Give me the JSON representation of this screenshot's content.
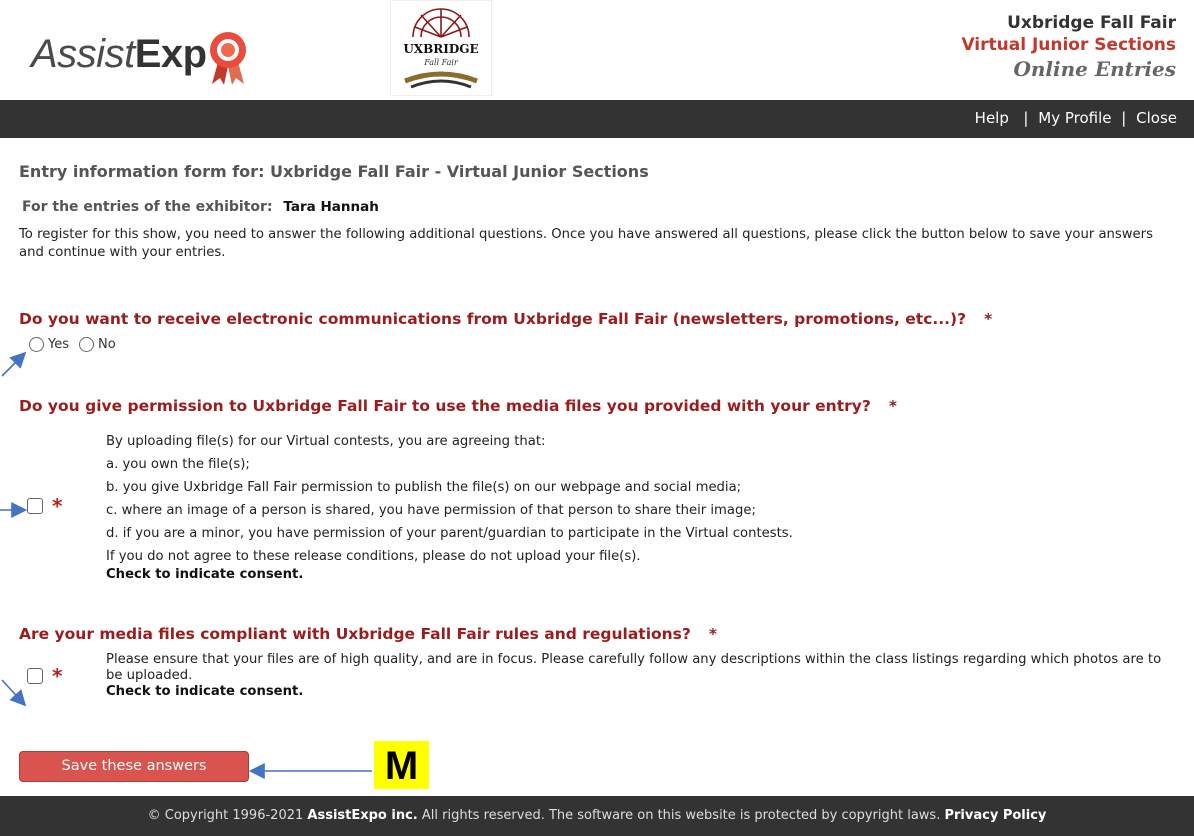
{
  "header": {
    "logo_light": "Assist",
    "logo_bold": "Exp",
    "badge_text": "UXBRIDGE",
    "badge_sub": "Fall Fair",
    "title_line1": "Uxbridge Fall Fair",
    "title_line2": "Virtual Junior Sections",
    "title_line3": "Online Entries"
  },
  "nav": {
    "help": "Help",
    "profile": "My Profile",
    "close": "Close"
  },
  "form": {
    "title": "Entry information form for: Uxbridge Fall Fair - Virtual Junior Sections",
    "exhibitor_label": "For the entries of the exhibitor:",
    "exhibitor_name": "Tara Hannah",
    "intro": "To register for this show, you need to answer the following additional questions. Once you have answered all questions, please click the button below to save your answers and continue with your entries."
  },
  "q1": {
    "title": "Do you want to receive electronic communications from Uxbridge Fall Fair (newsletters, promotions, etc...)?",
    "required": "*",
    "option_yes": "Yes",
    "option_no": "No"
  },
  "q2": {
    "title": "Do you give permission to Uxbridge Fall Fair to use the media files you provided with your entry?",
    "required": "*",
    "lines": [
      "By uploading file(s) for our Virtual contests, you are agreeing that:",
      "a. you own the file(s);",
      "b. you give Uxbridge Fall Fair permission to publish the file(s) on our webpage and social media;",
      "c. where an image of a person is shared, you have permission of that person to share their image;",
      "d. if you are a minor, you have permission of your parent/guardian to participate in the Virtual contests.",
      "If you do not agree to these release conditions, please do not upload your file(s)."
    ],
    "consent": "Check to indicate consent."
  },
  "q3": {
    "title": "Are your media files compliant with Uxbridge Fall Fair rules and regulations?",
    "required": "*",
    "text": "Please ensure that your files are of high quality, and are in focus. Please carefully follow any descriptions within the class listings regarding which photos are to be uploaded.",
    "consent": "Check to indicate consent."
  },
  "save_label": "Save these answers",
  "annotation_marker": "M",
  "footer": {
    "prefix": "© Copyright 1996-2021",
    "company": "AssistExpo inc.",
    "middle": "All rights reserved.  The software on this website is protected by copyright laws.",
    "privacy": "Privacy Policy"
  },
  "colors": {
    "accent_red": "#d9534f",
    "question_red": "#9b1c1c",
    "bar": "#333333",
    "annotation_blue": "#4472c4",
    "marker_yellow": "#ffff00"
  }
}
